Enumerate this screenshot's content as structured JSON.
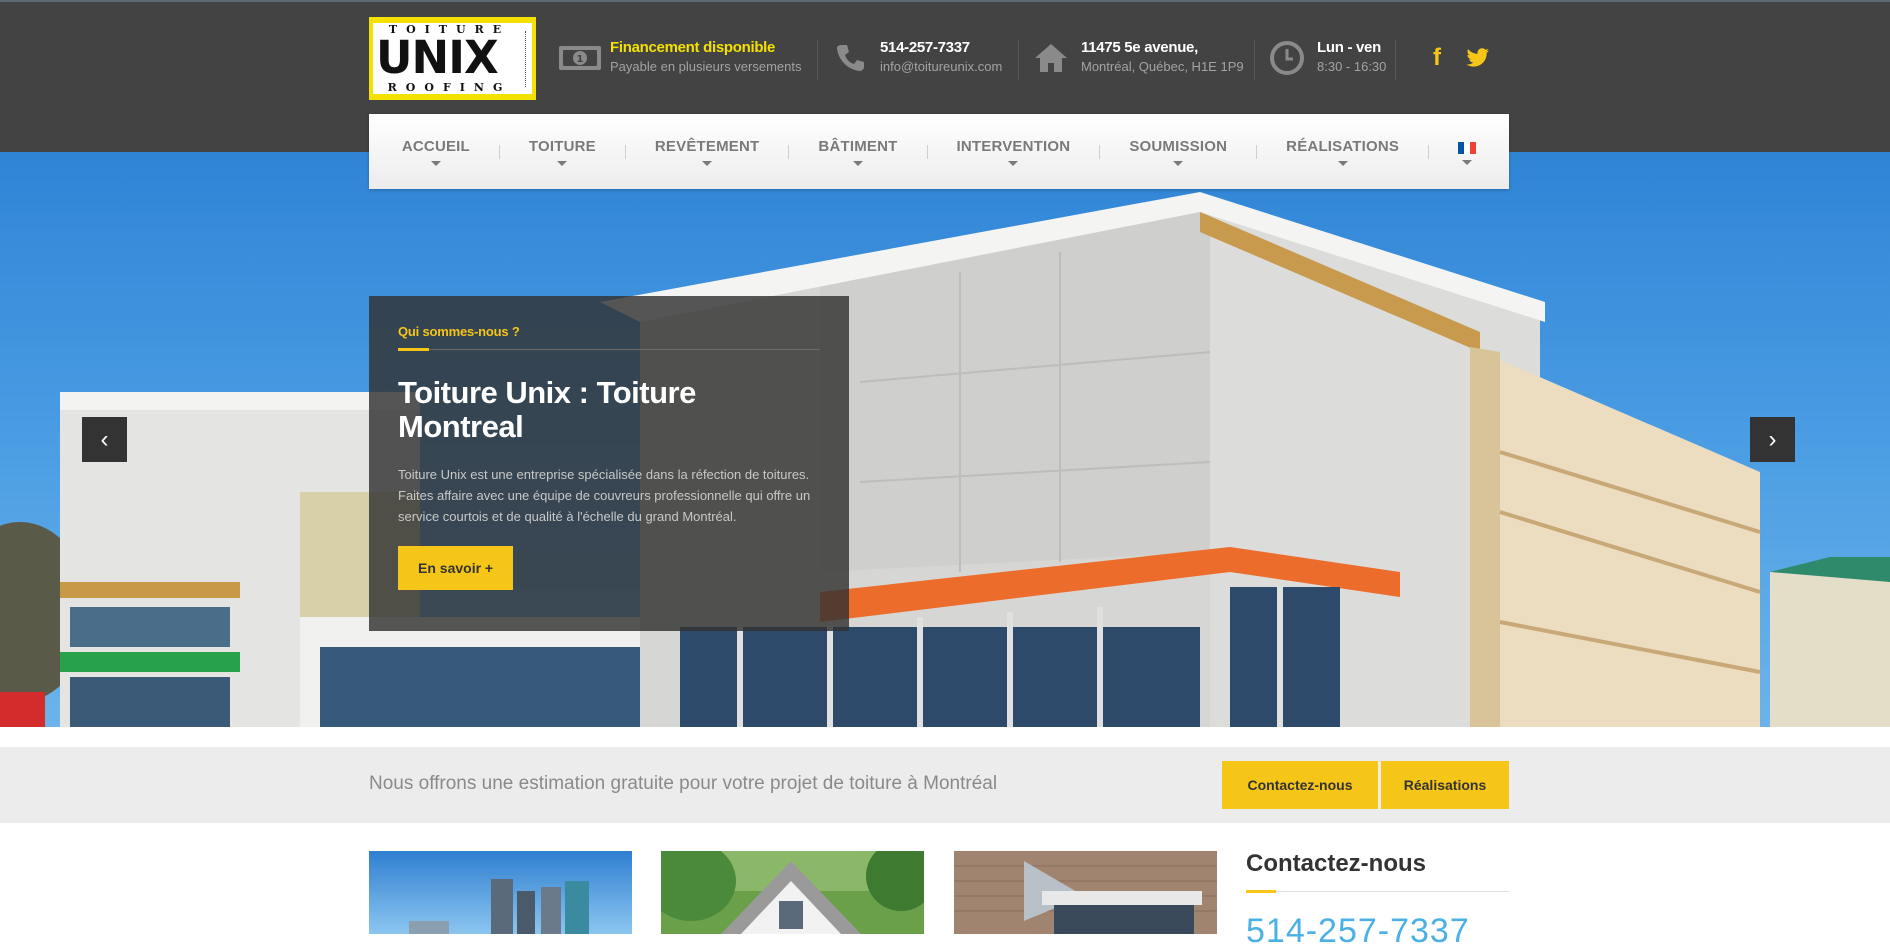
{
  "header": {
    "logo": {
      "top": "TOITURE",
      "main": "UNIX",
      "bottom": "ROOFING"
    },
    "financing": {
      "title": "Financement disponible",
      "subtitle": "Payable en plusieurs versements",
      "icon": "money-icon"
    },
    "phone": {
      "title": "514-257-7337",
      "subtitle": "info@toitureunix.com",
      "icon": "phone-icon"
    },
    "address": {
      "title": "11475 5e avenue,",
      "subtitle": "Montréal, Québec, H1E 1P9",
      "icon": "home-icon"
    },
    "hours": {
      "title": "Lun - ven",
      "subtitle": "8:30 - 16:30",
      "icon": "clock-icon"
    },
    "social": {
      "facebook": "f",
      "twitter": "twitter-icon"
    }
  },
  "nav": {
    "items": [
      {
        "label": "ACCUEIL"
      },
      {
        "label": "TOITURE"
      },
      {
        "label": "REVÊTEMENT"
      },
      {
        "label": "BÂTIMENT"
      },
      {
        "label": "INTERVENTION"
      },
      {
        "label": "SOUMISSION"
      },
      {
        "label": "RÉALISATIONS"
      }
    ],
    "language_icon": "french-flag-icon"
  },
  "hero": {
    "kicker": "Qui sommes-nous ?",
    "title": "Toiture Unix : Toiture Montreal",
    "body": "Toiture Unix est une entreprise spécialisée dans la réfection de toitures. Faites affaire avec une équipe de couvreurs professionnelle qui offre un service courtois et de qualité à l'échelle du grand Montréal.",
    "cta": "En savoir +",
    "prev": "‹",
    "next": "›"
  },
  "band": {
    "message": "Nous offrons une estimation gratuite pour votre projet de toiture à Montréal",
    "contact_button": "Contactez-nous",
    "projects_button": "Réalisations"
  },
  "contact": {
    "heading": "Contactez-nous",
    "phone": "514-257-7337"
  },
  "colors": {
    "accent": "#f5c518",
    "topbar": "#434343",
    "link_blue": "#4ab0e6"
  }
}
